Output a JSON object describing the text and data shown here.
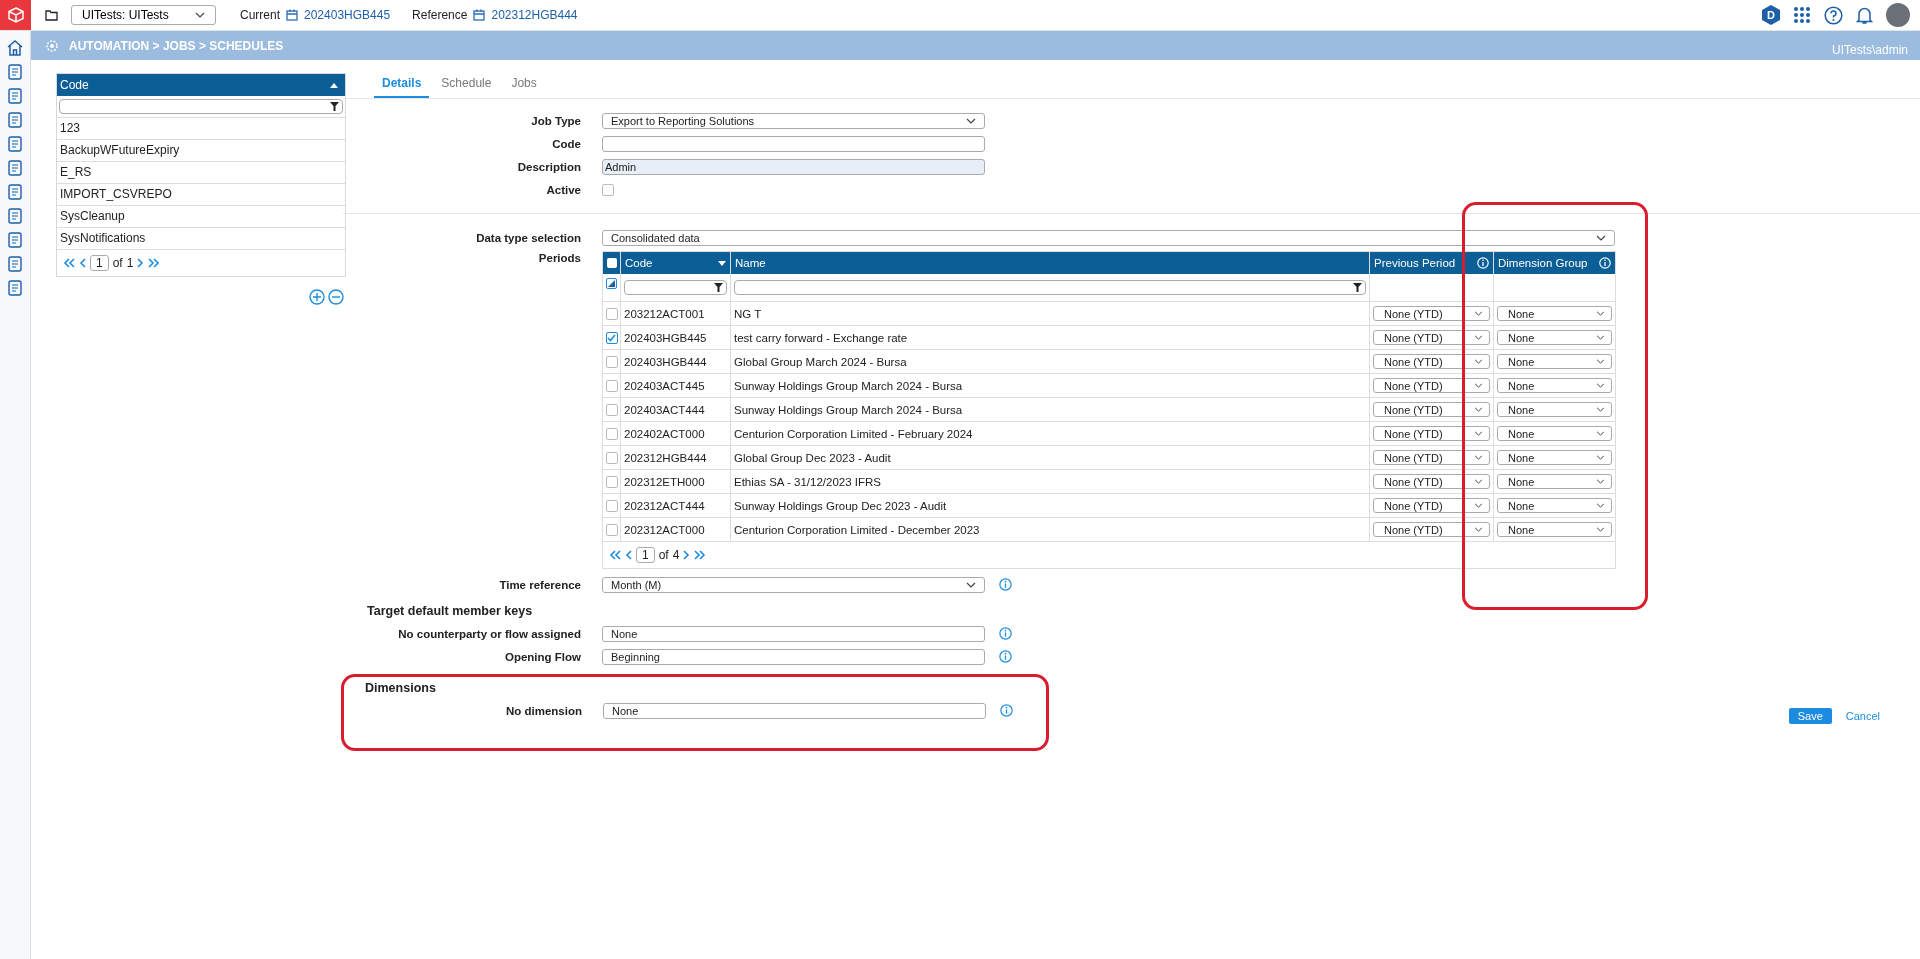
{
  "topbar": {
    "workspace": "UITests: UITests",
    "current_label": "Current",
    "current_value": "202403HGB445",
    "reference_label": "Reference",
    "reference_value": "202312HGB444",
    "product_badge": "D"
  },
  "breadcrumb": {
    "path": "AUTOMATION > JOBS > SCHEDULES",
    "user": "UITests\\admin"
  },
  "job_list": {
    "column": "Code",
    "rows": [
      {
        "code": "123",
        "selected": false
      },
      {
        "code": "BackupWFutureExpiry",
        "selected": false
      },
      {
        "code": "E_RS",
        "selected": false
      },
      {
        "code": "IMPORT_CSVREPO",
        "selected": false
      },
      {
        "code": "SysCleanup",
        "selected": false
      },
      {
        "code": "SysNotifications",
        "selected": false
      }
    ],
    "pager": {
      "page": "1",
      "of": "of",
      "total": "1"
    }
  },
  "tabs": [
    {
      "label": "Details",
      "selected": true
    },
    {
      "label": "Schedule",
      "selected": false
    },
    {
      "label": "Jobs",
      "selected": false
    }
  ],
  "form": {
    "job_type": {
      "label": "Job Type",
      "value": "Export to Reporting Solutions"
    },
    "code": {
      "label": "Code"
    },
    "description": {
      "label": "Description",
      "value": "Admin"
    },
    "active": {
      "label": "Active",
      "checked": false
    }
  },
  "data_type": {
    "label": "Data type selection",
    "value": "Consolidated data"
  },
  "periods": {
    "label": "Periods",
    "all_checked": false,
    "columns": [
      {
        "label": "Code",
        "highlighted": false
      },
      {
        "label": "Name",
        "highlighted": false
      },
      {
        "label": "Previous Period",
        "highlighted": false
      },
      {
        "label": "Dimension Group",
        "highlighted": true
      }
    ],
    "rows": [
      {
        "code": "203212ACT001",
        "name": "NG T",
        "checked": false,
        "previous_period": "None (YTD)",
        "dimension_group": "None"
      },
      {
        "code": "202403HGB445",
        "name": "test carry forward - Exchange rate",
        "checked": true,
        "previous_period": "None (YTD)",
        "dimension_group": "None"
      },
      {
        "code": "202403HGB444",
        "name": "Global Group March 2024 - Bursa",
        "checked": false,
        "previous_period": "None (YTD)",
        "dimension_group": "None"
      },
      {
        "code": "202403ACT445",
        "name": "Sunway Holdings Group March 2024 - Bursa",
        "checked": false,
        "previous_period": "None (YTD)",
        "dimension_group": "None"
      },
      {
        "code": "202403ACT444",
        "name": "Sunway Holdings Group March 2024 - Bursa",
        "checked": false,
        "previous_period": "None (YTD)",
        "dimension_group": "None"
      },
      {
        "code": "202402ACT000",
        "name": "Centurion Corporation Limited - February 2024",
        "checked": false,
        "previous_period": "None (YTD)",
        "dimension_group": "None"
      },
      {
        "code": "202312HGB444",
        "name": "Global Group Dec 2023 - Audit",
        "checked": false,
        "previous_period": "None (YTD)",
        "dimension_group": "None"
      },
      {
        "code": "202312ETH000",
        "name": "Ethias SA - 31/12/2023 IFRS",
        "checked": false,
        "previous_period": "None (YTD)",
        "dimension_group": "None"
      },
      {
        "code": "202312ACT444",
        "name": "Sunway Holdings Group Dec 2023 - Audit",
        "checked": false,
        "previous_period": "None (YTD)",
        "dimension_group": "None"
      },
      {
        "code": "202312ACT000",
        "name": "Centurion Corporation Limited - December 2023",
        "checked": false,
        "previous_period": "None (YTD)",
        "dimension_group": "None"
      }
    ],
    "pager": {
      "page": "1",
      "of": "of",
      "total": "4"
    }
  },
  "time_reference": {
    "label": "Time reference",
    "value": "Month (M)"
  },
  "member_keys": {
    "title": "Target default member keys",
    "fields": [
      {
        "label": "No counterparty or flow assigned",
        "value": "None"
      },
      {
        "label": "Opening Flow",
        "value": "Beginning"
      }
    ]
  },
  "dimensions": {
    "title": "Dimensions",
    "highlighted": true,
    "fields": [
      {
        "label": "No dimension",
        "value": "None"
      }
    ]
  },
  "buttons": {
    "save": "Save",
    "cancel": "Cancel"
  }
}
